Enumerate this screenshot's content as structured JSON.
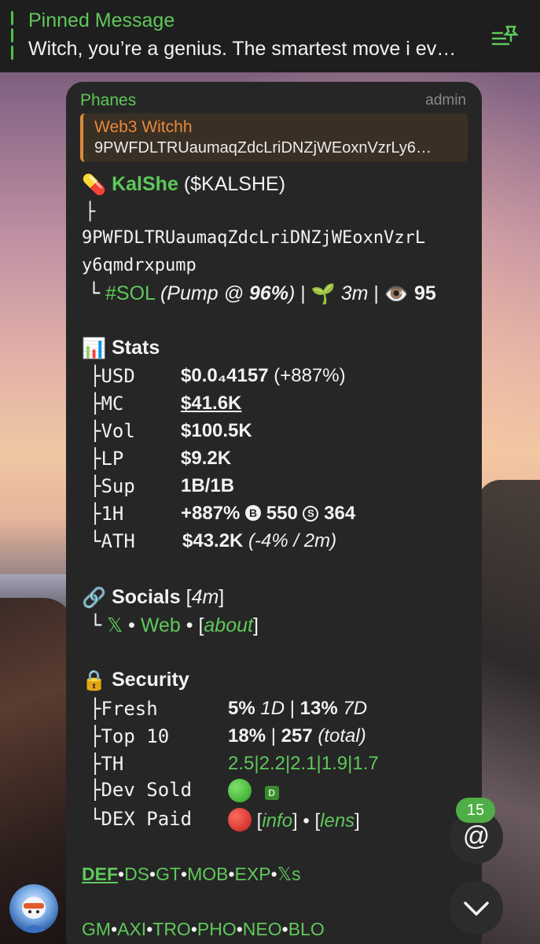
{
  "pinned": {
    "title": "Pinned Message",
    "text": "Witch, you’re a genius. The smartest move i ev…",
    "icon": "pin-list-icon"
  },
  "message": {
    "sender": "Phanes",
    "role": "admin",
    "reply": {
      "name": "Web3 Witchh",
      "text": "9PWFDLTRUaumaqZdcLriDNZjWEoxnVzrLy6…"
    },
    "token": {
      "emoji": "💊",
      "name": "KalShe",
      "ticker": "($KALSHE)",
      "branch": "├",
      "address_line1": "9PWFDLTRUaumaqZdcLriDNZjWEoxnVzrL",
      "address_line2": "y6qmdrxpump",
      "chain_prefix": "└",
      "chain": "#SOL",
      "pump": "(Pump @ ",
      "pump_pct": "96%",
      "pump_close": ")",
      "sep1": " | ",
      "age_emoji": "🌱",
      "age": "3m",
      "sep2": " | ",
      "views_emoji": "👁️",
      "views": "95"
    },
    "stats": {
      "emoji": "📊",
      "title": "Stats",
      "rows": [
        {
          "label": "├USD",
          "value": "$0.0₄4157",
          "extra": " (+887%)"
        },
        {
          "label": "├MC",
          "value": "$41.6K"
        },
        {
          "label": "├Vol",
          "value": "$100.5K"
        },
        {
          "label": "├LP",
          "value": "$9.2K"
        },
        {
          "label": "├Sup",
          "value": "1B/1B"
        },
        {
          "label": "├1H",
          "value": "+887%",
          "buy_badge": "B",
          "buys": "550",
          "sell_badge": "S",
          "sells": "364"
        },
        {
          "label": "└ATH",
          "value": "$43.2K",
          "extra": " (-4% / 2m)"
        }
      ]
    },
    "socials": {
      "emoji": "🔗",
      "title": "Socials",
      "age": "4m",
      "prefix": "└",
      "x": "𝕏",
      "dot1": " • ",
      "web": "Web",
      "dot2": " • ",
      "about": "about"
    },
    "security": {
      "emoji": "🔒",
      "title": "Security",
      "fresh_label": "├Fresh",
      "fresh_1d": "5%",
      "fresh_1d_unit": "1D",
      "fresh_7d": "13%",
      "fresh_7d_unit": "7D",
      "top10_label": "├Top 10",
      "top10_pct": "18%",
      "top10_total": "257",
      "top10_total_unit": "(total)",
      "th_label": "├TH",
      "th_values": "2.5|2.2|2.1|1.9|1.7",
      "devsold_label": "├Dev Sold",
      "devsold_badge": "D",
      "dexpaid_label": "└DEX Paid",
      "dexpaid_info": "info",
      "dexpaid_dot": " • ",
      "dexpaid_lens": "lens"
    },
    "links1": [
      "DEF",
      "DS",
      "GT",
      "MOB",
      "EXP",
      "𝕏s"
    ],
    "links2": [
      "GM",
      "AXI",
      "TRO",
      "PHO",
      "NEO",
      "BLO"
    ],
    "link_sep": "•"
  },
  "mention_count": "15",
  "mention_symbol": "@",
  "colors": {
    "accent_green": "#5fc85a",
    "reply_orange": "#e8893b",
    "bubble": "#262626"
  }
}
